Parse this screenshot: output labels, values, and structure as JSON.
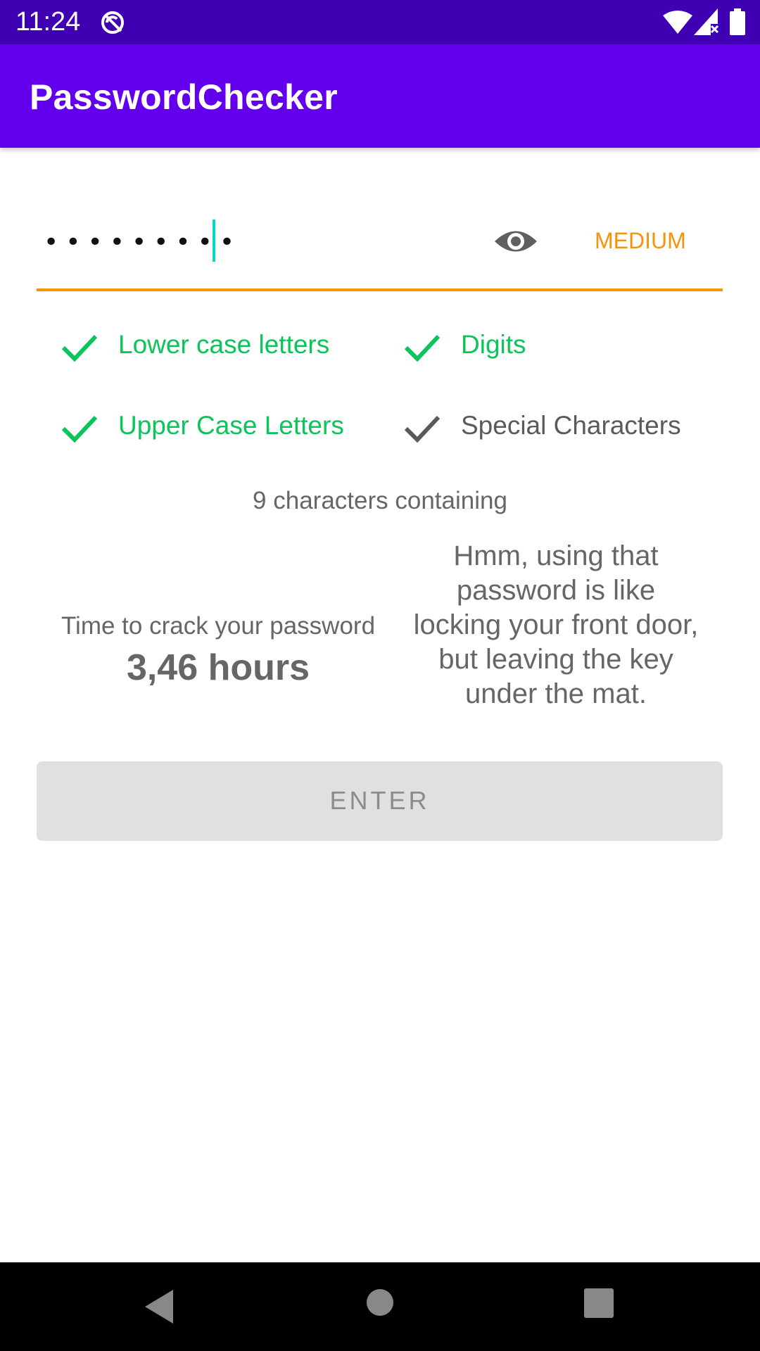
{
  "status_bar": {
    "time": "11:24"
  },
  "app_bar": {
    "title": "PasswordChecker"
  },
  "password_field": {
    "masked_value": "•••••••••",
    "strength_label": "MEDIUM",
    "strength_color": "#f5940a"
  },
  "criteria": [
    {
      "label": "Lower case letters",
      "met": true
    },
    {
      "label": "Digits",
      "met": true
    },
    {
      "label": "Upper Case Letters",
      "met": true
    },
    {
      "label": "Special Characters",
      "met": false
    }
  ],
  "summary": {
    "char_count_text": "9 characters containing"
  },
  "crack": {
    "label": "Time to crack your password",
    "time": "3,46 hours"
  },
  "advice": {
    "text": "Hmm, using that password is like locking your front door, but leaving the key under the mat."
  },
  "enter_button": {
    "label": "ENTER"
  },
  "colors": {
    "status_bar": "#3f00b4",
    "app_bar": "#6200ee",
    "criteria_met": "#0bc45a",
    "criteria_unmet": "#5a5a5a",
    "cursor": "#03dac5"
  },
  "icons": {
    "sync": "sync-off-icon",
    "wifi": "wifi-icon",
    "signal": "signal-icon",
    "battery": "battery-icon",
    "visibility": "eye-icon",
    "check": "check-icon",
    "nav_back": "back-triangle-icon",
    "nav_home": "home-circle-icon",
    "nav_recents": "recents-square-icon"
  }
}
